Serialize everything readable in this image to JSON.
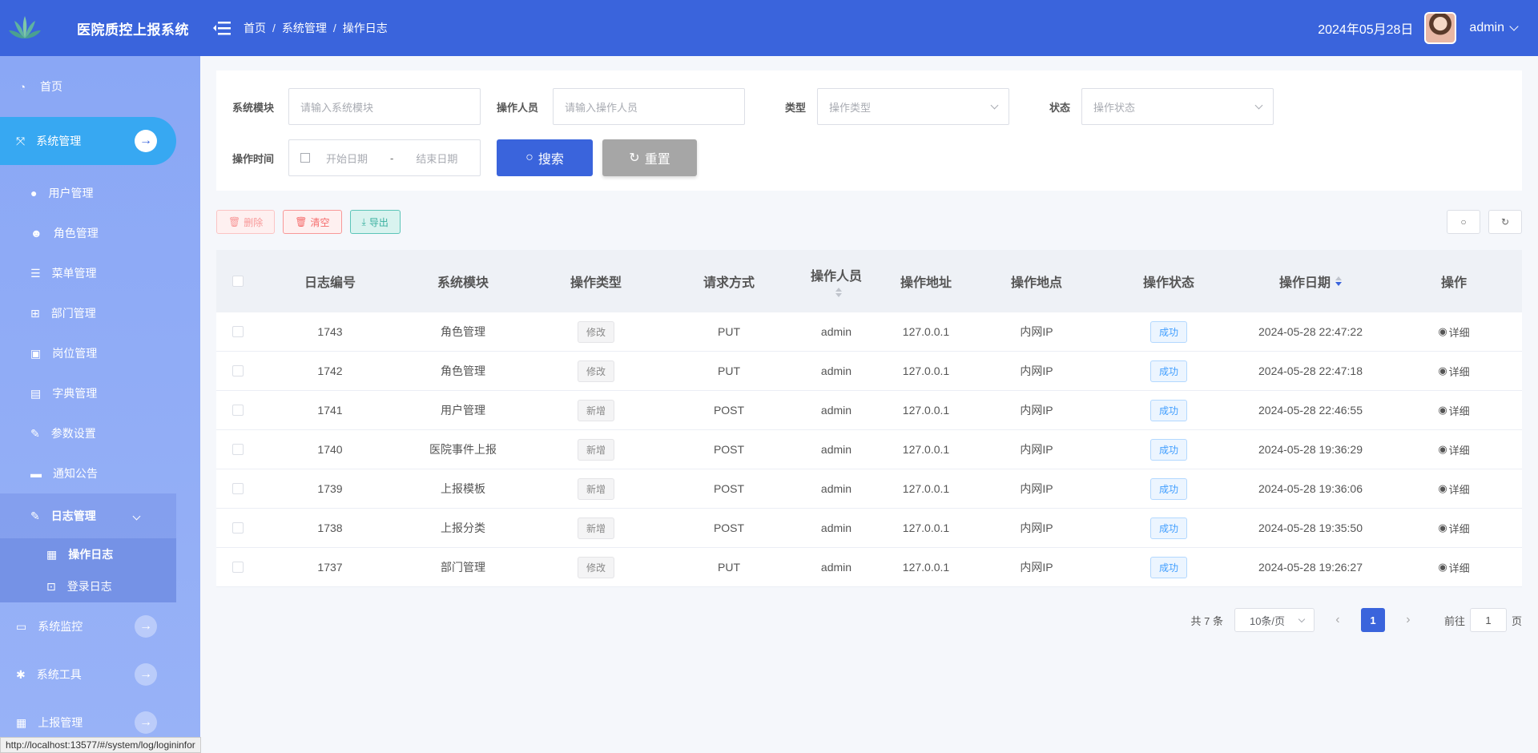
{
  "header": {
    "app_title": "医院质控上报系统",
    "breadcrumb": [
      "首页",
      "系统管理",
      "操作日志"
    ],
    "date": "2024年05月28日",
    "user": "admin"
  },
  "sidebar": {
    "home": "首页",
    "system": "系统管理",
    "items": [
      "用户管理",
      "角色管理",
      "菜单管理",
      "部门管理",
      "岗位管理",
      "字典管理",
      "参数设置",
      "通知公告"
    ],
    "log_group": "日志管理",
    "log_items": [
      "操作日志",
      "登录日志"
    ],
    "groups": [
      "系统监控",
      "系统工具",
      "上报管理"
    ]
  },
  "filter": {
    "module_label": "系统模块",
    "module_placeholder": "请输入系统模块",
    "operator_label": "操作人员",
    "operator_placeholder": "请输入操作人员",
    "type_label": "类型",
    "type_placeholder": "操作类型",
    "status_label": "状态",
    "status_placeholder": "操作状态",
    "time_label": "操作时间",
    "start_placeholder": "开始日期",
    "range_sep": "-",
    "end_placeholder": "结束日期",
    "search": "搜索",
    "reset": "重置"
  },
  "toolbar": {
    "delete": "删除",
    "clear": "清空",
    "export": "导出"
  },
  "table": {
    "columns": [
      "日志编号",
      "系统模块",
      "操作类型",
      "请求方式",
      "操作人员",
      "操作地址",
      "操作地点",
      "操作状态",
      "操作日期",
      "操作"
    ],
    "rows": [
      {
        "id": "1743",
        "module": "角色管理",
        "type": "修改",
        "method": "PUT",
        "operator": "admin",
        "ip": "127.0.0.1",
        "location": "内网IP",
        "status": "成功",
        "date": "2024-05-28 22:47:22",
        "action": "详细"
      },
      {
        "id": "1742",
        "module": "角色管理",
        "type": "修改",
        "method": "PUT",
        "operator": "admin",
        "ip": "127.0.0.1",
        "location": "内网IP",
        "status": "成功",
        "date": "2024-05-28 22:47:18",
        "action": "详细"
      },
      {
        "id": "1741",
        "module": "用户管理",
        "type": "新增",
        "method": "POST",
        "operator": "admin",
        "ip": "127.0.0.1",
        "location": "内网IP",
        "status": "成功",
        "date": "2024-05-28 22:46:55",
        "action": "详细"
      },
      {
        "id": "1740",
        "module": "医院事件上报",
        "type": "新增",
        "method": "POST",
        "operator": "admin",
        "ip": "127.0.0.1",
        "location": "内网IP",
        "status": "成功",
        "date": "2024-05-28 19:36:29",
        "action": "详细"
      },
      {
        "id": "1739",
        "module": "上报模板",
        "type": "新增",
        "method": "POST",
        "operator": "admin",
        "ip": "127.0.0.1",
        "location": "内网IP",
        "status": "成功",
        "date": "2024-05-28 19:36:06",
        "action": "详细"
      },
      {
        "id": "1738",
        "module": "上报分类",
        "type": "新增",
        "method": "POST",
        "operator": "admin",
        "ip": "127.0.0.1",
        "location": "内网IP",
        "status": "成功",
        "date": "2024-05-28 19:35:50",
        "action": "详细"
      },
      {
        "id": "1737",
        "module": "部门管理",
        "type": "修改",
        "method": "PUT",
        "operator": "admin",
        "ip": "127.0.0.1",
        "location": "内网IP",
        "status": "成功",
        "date": "2024-05-28 19:26:27",
        "action": "详细"
      }
    ]
  },
  "pagination": {
    "total": "共 7 条",
    "page_size": "10条/页",
    "current": "1",
    "goto_prefix": "前往",
    "goto_value": "1",
    "goto_suffix": "页"
  },
  "statusbar": "http://localhost:13577/#/system/log/logininfor"
}
